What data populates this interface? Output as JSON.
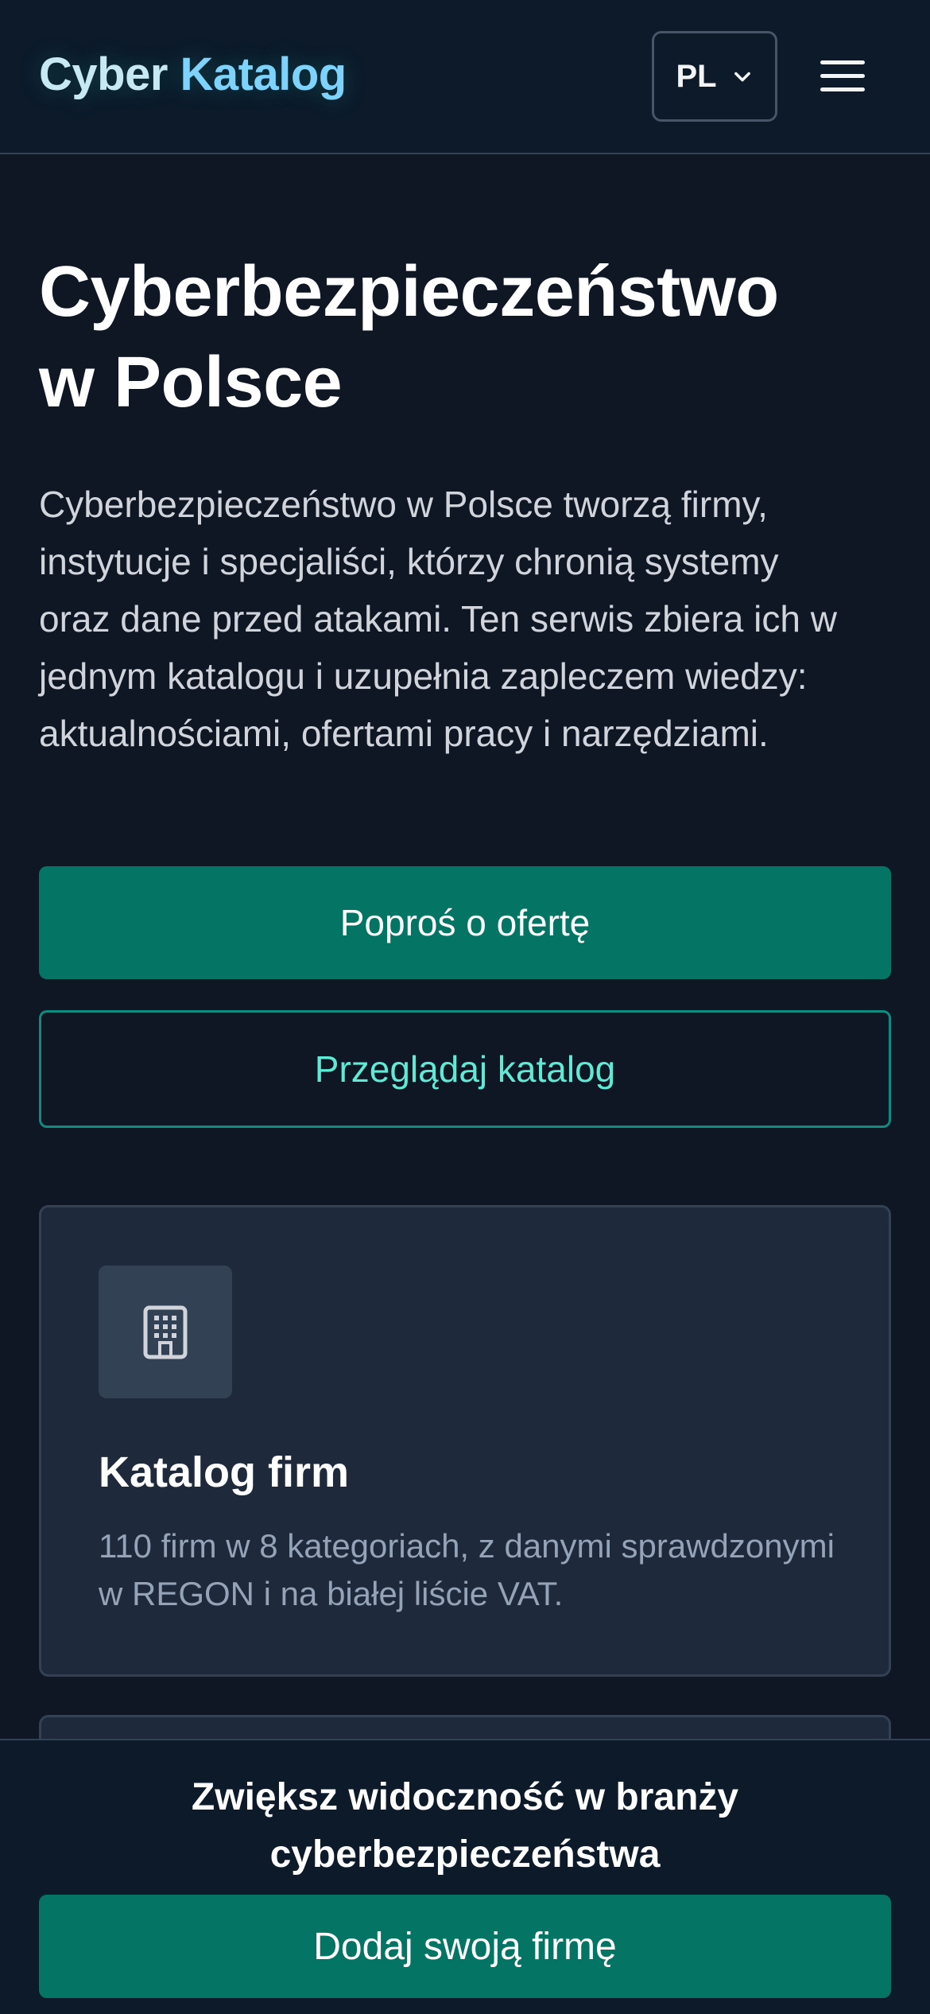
{
  "header": {
    "brand_part1": "Cyber",
    "brand_part2": "Katalog",
    "language": "PL",
    "icons": {
      "language_dropdown": "chevron-down-icon",
      "menu": "hamburger-menu-icon"
    }
  },
  "hero": {
    "title_line1": "Cyberbezpieczeństwo",
    "title_line2": "w Polsce",
    "description": "Cyberbezpieczeństwo w Polsce tworzą firmy, instytucje i specjaliści, którzy chronią systemy oraz dane przed atakami. Ten serwis zbiera ich w jednym katalogu i uzupełnia zapleczem wiedzy: aktualnościami, ofertami pracy i narzędziami.",
    "primary_button": "Poproś o ofertę",
    "secondary_button": "Przeglądaj katalog"
  },
  "cards": [
    {
      "icon": "building-icon",
      "title": "Katalog firm",
      "description": "110 firm w 8 kategoriach, z danymi sprawdzonymi w REGON i na białej liście VAT."
    }
  ],
  "bottom_bar": {
    "title_line1": "Zwiększ widoczność w branży",
    "title_line2": "cyberbezpieczeństwa",
    "button": "Dodaj swoją firmę"
  },
  "colors": {
    "background": "#0f1624",
    "header_background": "#0c1a2a",
    "card_background": "#1e293b",
    "accent": "#047565",
    "accent_text": "#5eead4",
    "brand_primary": "#c7e9f4",
    "brand_secondary": "#7dd3fc"
  }
}
